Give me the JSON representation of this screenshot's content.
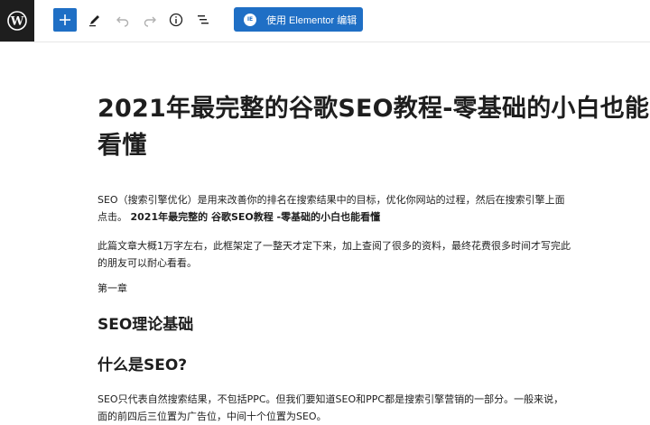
{
  "toolbar": {
    "wp_logo_icon": "wordpress-logo-icon",
    "add_icon": "plus-icon",
    "edit_icon": "pencil-icon",
    "undo_icon": "undo-icon",
    "redo_icon": "redo-icon",
    "info_icon": "info-icon",
    "outline_icon": "list-view-icon",
    "elementor_label": "使用 Elementor 编辑",
    "accent_color": "#1f6fc5"
  },
  "post": {
    "title": "2021年最完整的谷歌SEO教程-零基础的小白也能看懂",
    "p1_line1": "SEO（搜索引擎优化）是用来改善你的排名在搜索结果中的目标，优化你网站的过程，然后在搜索引擎上面",
    "p1_line2_prefix": "点击。",
    "p1_line2_bold": "2021年最完整的 谷歌SEO教程 -零基础的小白也能看懂",
    "p2_line1": "此篇文章大概1万字左右，此框架定了一整天才定下来，加上查阅了很多的资料，最终花费很多时间才写完此",
    "p2_line2": "的朋友可以耐心看看。",
    "chapter": "第一章",
    "heading1": "SEO理论基础",
    "heading2": "什么是SEO?",
    "p3_line1": "SEO只代表自然搜索结果，不包括PPC。但我们要知道SEO和PPC都是搜索引擎营销的一部分。一般来说，",
    "p3_line2": "面的前四后三位置为广告位，中间十个位置为SEO。"
  }
}
